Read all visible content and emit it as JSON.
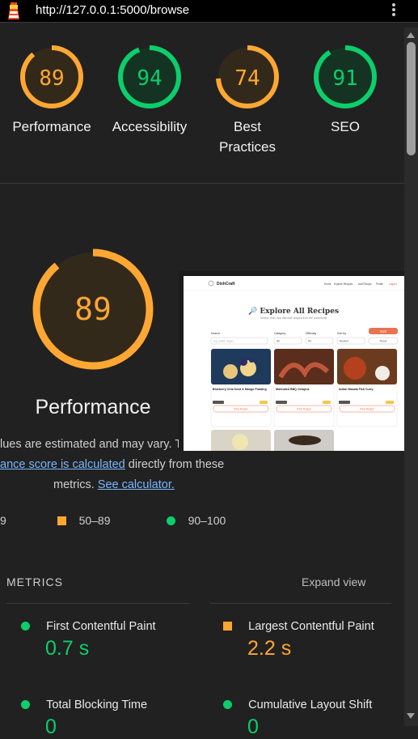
{
  "browser": {
    "url": "http://127.0.0.1:5000/browse"
  },
  "colors": {
    "pass": "#0cce6b",
    "average": "#ffa733",
    "fail": "#ff4e42",
    "link": "#7ab6ff"
  },
  "gauges": [
    {
      "score": "89",
      "label": "Performance",
      "value": 0.89,
      "rating": "average"
    },
    {
      "score": "94",
      "label": "Accessibility",
      "value": 0.94,
      "rating": "pass"
    },
    {
      "score": "74",
      "label": "Best Practices",
      "value": 0.74,
      "rating": "average"
    },
    {
      "score": "91",
      "label": "SEO",
      "value": 0.91,
      "rating": "pass"
    }
  ],
  "performance": {
    "score": "89",
    "value": 0.89,
    "title": "Performance",
    "note_line1": "lues are estimated and may vary. T",
    "note_link1": "ance score is calculated",
    "note_line2_rest": " directly from these",
    "note_line3": "metrics. ",
    "note_link2": "See calculator."
  },
  "legend": {
    "fail_range": "9",
    "average_range": "50–89",
    "pass_range": "90–100"
  },
  "metrics": {
    "heading": "METRICS",
    "expand": "Expand view",
    "items": [
      {
        "name": "First Contentful Paint",
        "value": "0.7 s",
        "rating": "pass"
      },
      {
        "name": "Largest Contentful Paint",
        "value": "2.2 s",
        "rating": "average"
      },
      {
        "name": "Total Blocking Time",
        "value": "0",
        "rating": "pass"
      },
      {
        "name": "Cumulative Layout Shift",
        "value": "0",
        "rating": "pass"
      }
    ]
  },
  "thumbnail": {
    "brand": "DishCraft",
    "nav": [
      "Home",
      "Explore Recipes",
      "Add Recipe",
      "Profile",
      "Logout"
    ],
    "heading": "🔎 Explore All Recipes",
    "subheading": "Search, filter, and discover recipes from the community",
    "search_label": "Search",
    "search_placeholder": "e.g. pasta, vegan...",
    "category_label": "Category",
    "difficulty_label": "Difficulty",
    "sort_label": "Sort by",
    "filter_all": "All",
    "sort_value": "Newest",
    "apply": "Apply",
    "reset": "Reset",
    "cards": [
      {
        "title": "Blueberry Chia Seed & Mango Pudding",
        "button": "View Recipe"
      },
      {
        "title": "Marinated BBQ Octopus",
        "button": "View Recipe"
      },
      {
        "title": "Indian Masala Fish Curry",
        "button": "View Recipe"
      }
    ]
  }
}
